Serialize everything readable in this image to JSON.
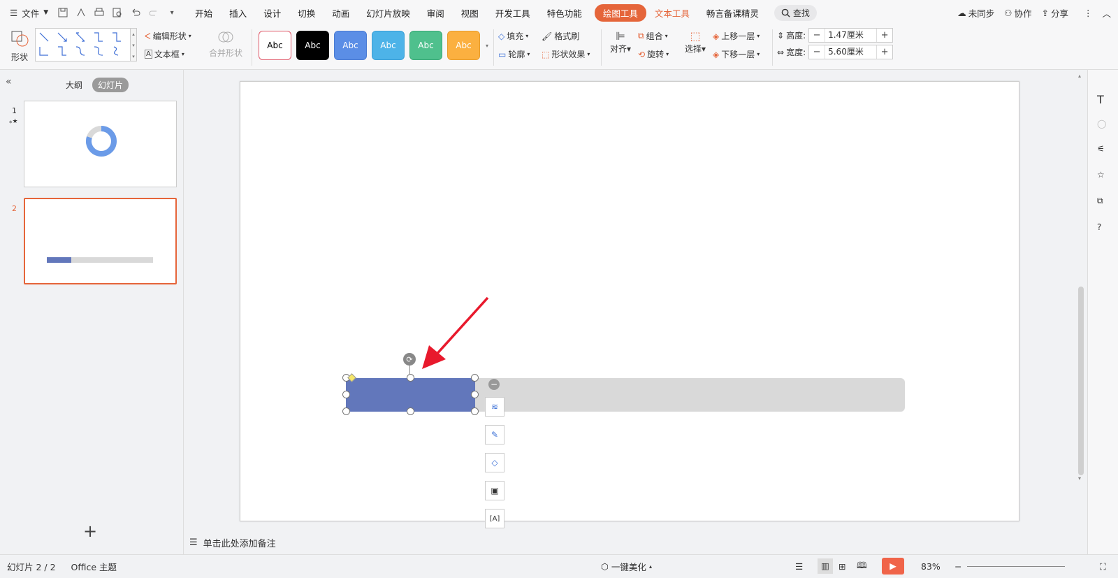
{
  "menubar": {
    "file_label": "文件",
    "tabs": [
      "开始",
      "插入",
      "设计",
      "切换",
      "动画",
      "幻灯片放映",
      "审阅",
      "视图",
      "开发工具",
      "特色功能"
    ],
    "active_tab": "绘图工具",
    "text_tools_tab": "文本工具",
    "plugin_tab": "畅言备课精灵",
    "search_label": "查找",
    "sync_label": "未同步",
    "collab_label": "协作",
    "share_label": "分享"
  },
  "ribbon": {
    "shape_label": "形状",
    "edit_shape_label": "编辑形状",
    "textbox_label": "文本框",
    "merge_shape_label": "合并形状",
    "style_boxes": [
      {
        "label": "Abc",
        "bg": "#ffffff",
        "fg": "#000000",
        "border": "#e05a6a"
      },
      {
        "label": "Abc",
        "bg": "#000000",
        "fg": "#ffffff",
        "border": "#000000"
      },
      {
        "label": "Abc",
        "bg": "#5b8ee6",
        "fg": "#ffffff",
        "border": "#4a7bd2"
      },
      {
        "label": "Abc",
        "bg": "#4db3e8",
        "fg": "#ffffff",
        "border": "#3a9fd6"
      },
      {
        "label": "Abc",
        "bg": "#4fc08d",
        "fg": "#ffffff",
        "border": "#3aa877"
      },
      {
        "label": "Abc",
        "bg": "#fbb040",
        "fg": "#ffffff",
        "border": "#e89c2a"
      }
    ],
    "fill_label": "填充",
    "format_painter_label": "格式刷",
    "outline_label": "轮廓",
    "shape_effect_label": "形状效果",
    "align_label": "对齐",
    "group_label": "组合",
    "rotate_label": "旋转",
    "select_label": "选择",
    "bring_forward_label": "上移一层",
    "send_backward_label": "下移一层",
    "height_label": "高度:",
    "height_value": "1.47厘米",
    "width_label": "宽度:",
    "width_value": "5.60厘米"
  },
  "leftpanel": {
    "outline_tab": "大纲",
    "slides_tab": "幻灯片",
    "slide1_num": "1",
    "slide2_num": "2",
    "add_slide": "+"
  },
  "notes_placeholder": "单击此处添加备注",
  "status": {
    "slide_info": "幻灯片 2 / 2",
    "theme": "Office 主题",
    "beautify": "一键美化",
    "zoom": "83%"
  },
  "progress_fraction": 0.23,
  "colors": {
    "accent": "#e5653a",
    "bar": "#6277bb",
    "track": "#d9d9d9"
  }
}
